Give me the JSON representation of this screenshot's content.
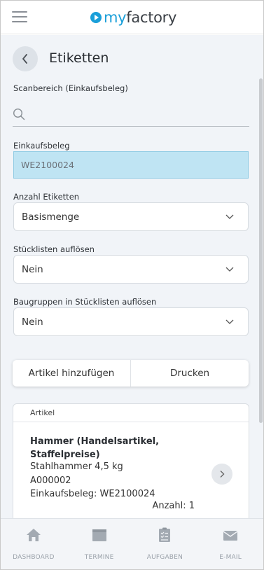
{
  "header": {
    "logo_my": "my",
    "logo_factory": "factory"
  },
  "page": {
    "title": "Etiketten"
  },
  "form": {
    "scan_label": "Scanbereich (Einkaufsbeleg)",
    "scan_value": "",
    "beleg_label": "Einkaufsbeleg",
    "beleg_value": "WE2100024",
    "anzahl_label": "Anzahl Etiketten",
    "anzahl_value": "Basismenge",
    "stueckliste_label": "Stücklisten auflösen",
    "stueckliste_value": "Nein",
    "baugruppen_label": "Baugruppen in Stücklisten auflösen",
    "baugruppen_value": "Nein"
  },
  "actions": {
    "add_label": "Artikel hinzufügen",
    "print_label": "Drucken"
  },
  "article_card": {
    "header": "Artikel",
    "title": "Hammer (Handelsartikel, Staffelpreise)",
    "line1": "Stahlhammer 4,5 kg",
    "line2": "A000002",
    "line3": "Einkaufsbeleg: WE2100024",
    "quantity": "Anzahl: 1"
  },
  "bottom_nav": {
    "items": [
      {
        "label": "DASHBOARD",
        "icon": "home-icon"
      },
      {
        "label": "TERMINE",
        "icon": "calendar-icon"
      },
      {
        "label": "AUFGABEN",
        "icon": "clipboard-icon"
      },
      {
        "label": "E-MAIL",
        "icon": "mail-icon"
      }
    ]
  },
  "colors": {
    "brand": "#1a9fd9",
    "highlight_input": "#bfe4f3",
    "background": "#f1f4f8",
    "nav_icon": "#a3aab2"
  }
}
